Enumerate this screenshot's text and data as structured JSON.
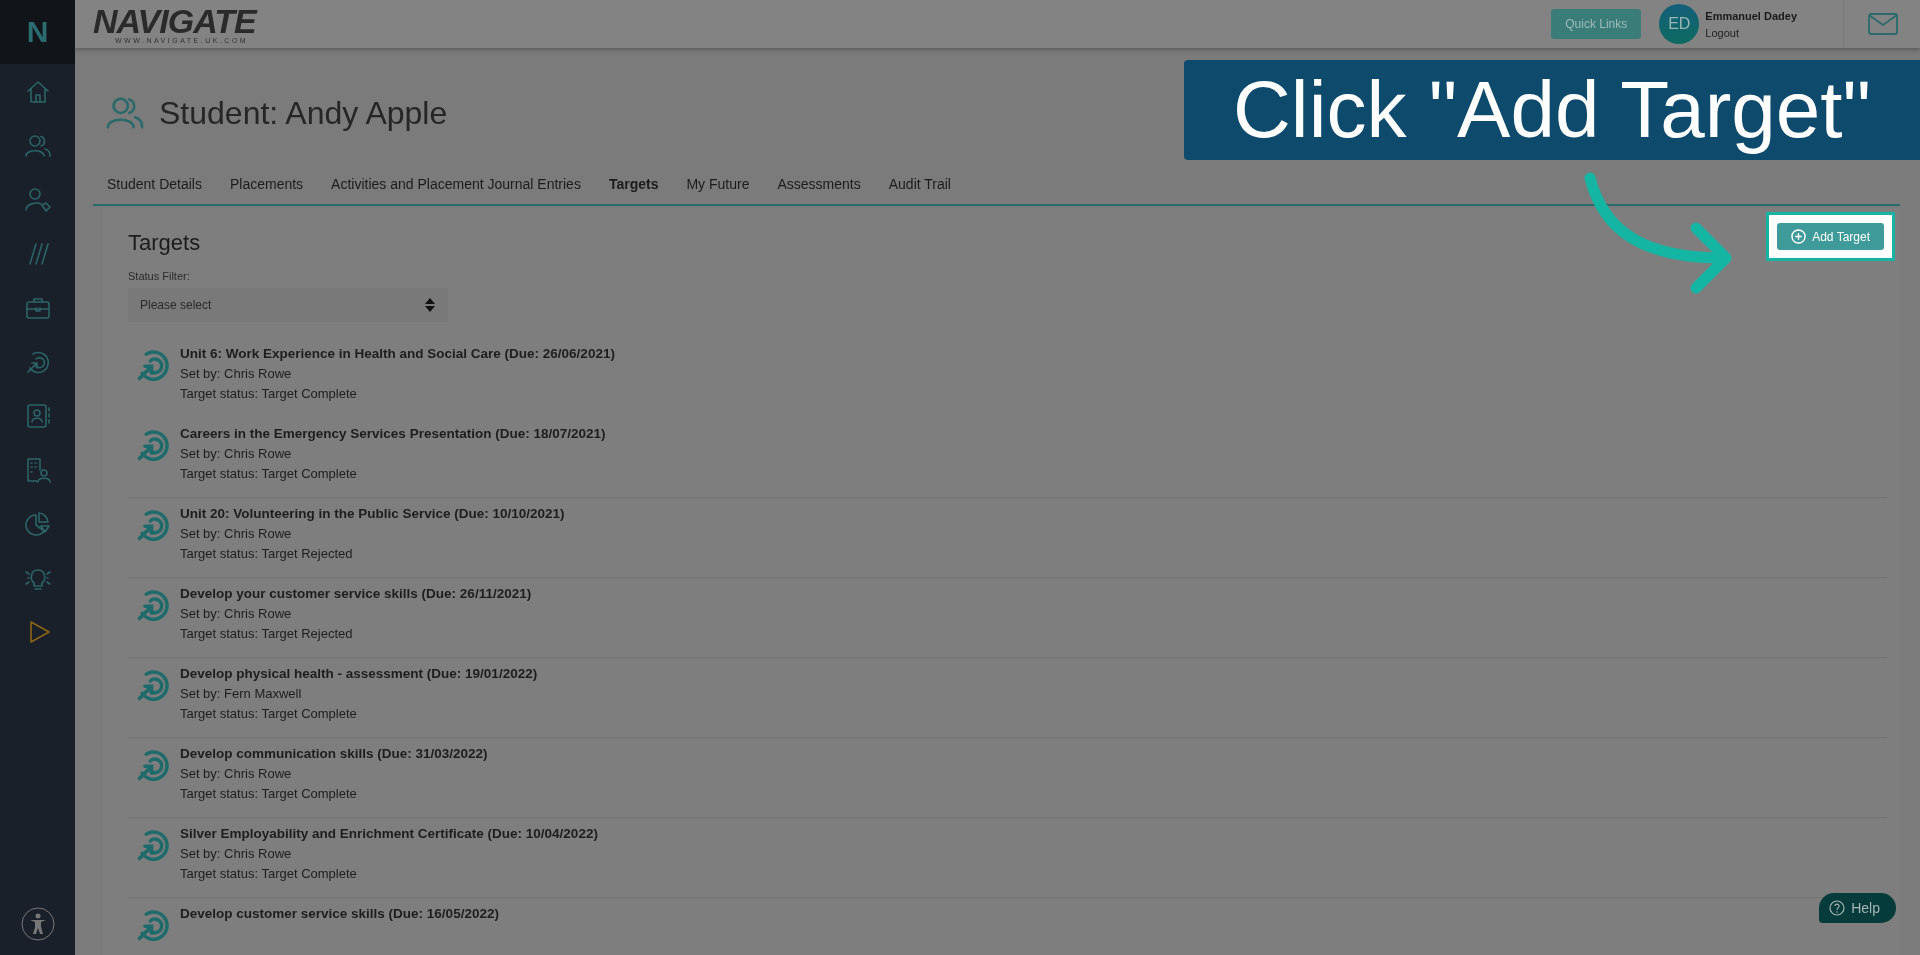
{
  "sidebar": {
    "logo": "N",
    "items": [
      {
        "kind": "home",
        "color": "#2b6466"
      },
      {
        "kind": "people",
        "color": "#2b6466"
      },
      {
        "kind": "person-tag",
        "color": "#2b6466"
      },
      {
        "kind": "slashes",
        "color": "#2b6466"
      },
      {
        "kind": "briefcase",
        "color": "#2b6466"
      },
      {
        "kind": "target",
        "color": "#2b6466"
      },
      {
        "kind": "contact-book",
        "color": "#2b6466"
      },
      {
        "kind": "building-person",
        "color": "#2b6466"
      },
      {
        "kind": "pie-chart",
        "color": "#2b6466"
      },
      {
        "kind": "lightbulb",
        "color": "#2b6466"
      },
      {
        "kind": "play",
        "color": "#8a6416"
      }
    ]
  },
  "header": {
    "logo": "NAVIGATE",
    "logo_url": "WWW.NAVIGATE.UK.COM",
    "quick_links": "Quick Links",
    "user": {
      "initials": "ED",
      "name": "Emmanuel Dadey",
      "logout": "Logout"
    }
  },
  "page": {
    "title": "Student: Andy Apple",
    "tabs": [
      {
        "label": "Student Details",
        "selected": false
      },
      {
        "label": "Placements",
        "selected": false
      },
      {
        "label": "Activities and Placement Journal Entries",
        "selected": false
      },
      {
        "label": "Targets",
        "selected": true
      },
      {
        "label": "My Future",
        "selected": false
      },
      {
        "label": "Assessments",
        "selected": false
      },
      {
        "label": "Audit Trail",
        "selected": false
      }
    ],
    "section_title": "Targets",
    "add_button": "Add Target",
    "status_filter": {
      "label": "Status Filter:",
      "placeholder": "Please select"
    },
    "targets": [
      {
        "title": "Unit 6: Work Experience in Health and Social Care (Due: 26/06/2021)",
        "set_by": "Set by: Chris Rowe",
        "status": "Target status: Target Complete"
      },
      {
        "title": "Careers in the Emergency Services Presentation (Due: 18/07/2021)",
        "set_by": "Set by: Chris Rowe",
        "status": "Target status: Target Complete"
      },
      {
        "title": "Unit 20: Volunteering in the Public Service (Due: 10/10/2021)",
        "set_by": "Set by: Chris Rowe",
        "status": "Target status: Target Rejected"
      },
      {
        "title": "Develop your customer service skills (Due: 26/11/2021)",
        "set_by": "Set by: Chris Rowe",
        "status": "Target status: Target Rejected"
      },
      {
        "title": "Develop physical health - assessment (Due: 19/01/2022)",
        "set_by": "Set by: Fern Maxwell",
        "status": "Target status: Target Complete"
      },
      {
        "title": "Develop communication skills (Due: 31/03/2022)",
        "set_by": "Set by: Chris Rowe",
        "status": "Target status: Target Complete"
      },
      {
        "title": "Silver Employability and Enrichment Certificate (Due: 10/04/2022)",
        "set_by": "Set by: Chris Rowe",
        "status": "Target status: Target Complete"
      },
      {
        "title": "Develop customer service skills (Due: 16/05/2022)"
      }
    ]
  },
  "help": "Help",
  "callout": "Click \"Add Target\""
}
